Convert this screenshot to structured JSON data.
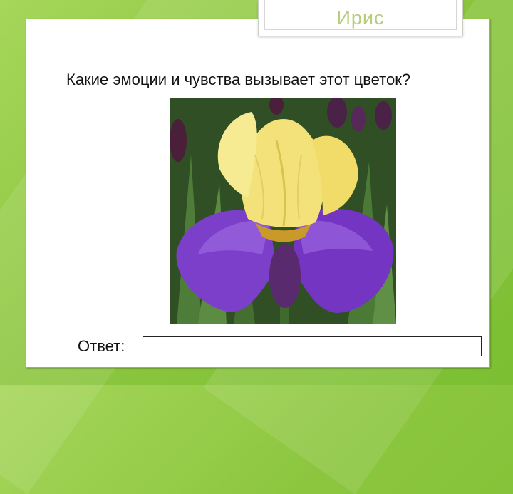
{
  "slide": {
    "title": "Ирис",
    "question": "Какие эмоции и чувства вызывает этот цветок?",
    "answer_label": "Ответ:",
    "answer_value": ""
  },
  "image": {
    "subject": "iris-flower-photo",
    "colors": {
      "petal_yellow": "#f3e27a",
      "petal_purple": "#7a3fc9",
      "foliage": "#3d6b2e"
    }
  },
  "theme": {
    "background": "#8cc63f",
    "title_color": "#b9ce7a"
  }
}
